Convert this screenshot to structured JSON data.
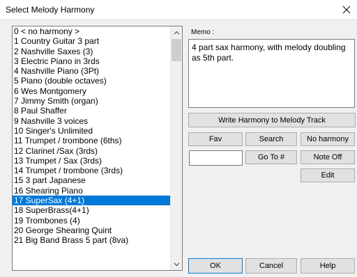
{
  "window": {
    "title": "Select Melody Harmony"
  },
  "harmony_list": {
    "items": [
      "0 < no harmony >",
      "1 Country Guitar 3 part",
      "2 Nashville Saxes (3)",
      "3 Electric Piano in 3rds",
      "4 Nashville Piano (3Pt)",
      "5 Piano (double octaves)",
      "6 Wes Montgomery",
      "7 Jimmy Smith (organ)",
      "8 Paul Shaffer",
      "9 Nashville 3 voices",
      "10 Singer's Unlimited",
      "11 Trumpet / trombone (6ths)",
      "12 Clarinet /Sax (3rds)",
      "13 Trumpet / Sax (3rds)",
      "14 Trumpet / trombone (3rds)",
      "15 3 part Japanese",
      "16 Shearing Piano",
      "17 SuperSax (4+1)",
      "18 SuperBrass(4+1)",
      "19 Trombones (4)",
      "20 George Shearing Quint",
      "21 Big Band Brass 5 part (8va)"
    ],
    "selected_index": 17
  },
  "memo": {
    "label": "Memo :",
    "text": "4 part sax harmony, with melody doubling as 5th part."
  },
  "buttons": {
    "write_harmony": "Write Harmony to Melody Track",
    "fav": "Fav",
    "search": "Search",
    "no_harmony": "No harmony",
    "go_to": "Go To #",
    "note_off": "Note Off",
    "edit": "Edit",
    "ok": "OK",
    "cancel": "Cancel",
    "help": "Help"
  },
  "goto_input": {
    "value": ""
  },
  "colors": {
    "selection": "#0078d7",
    "dialog_bg": "#f0f0f0",
    "button_bg": "#e1e1e1"
  }
}
